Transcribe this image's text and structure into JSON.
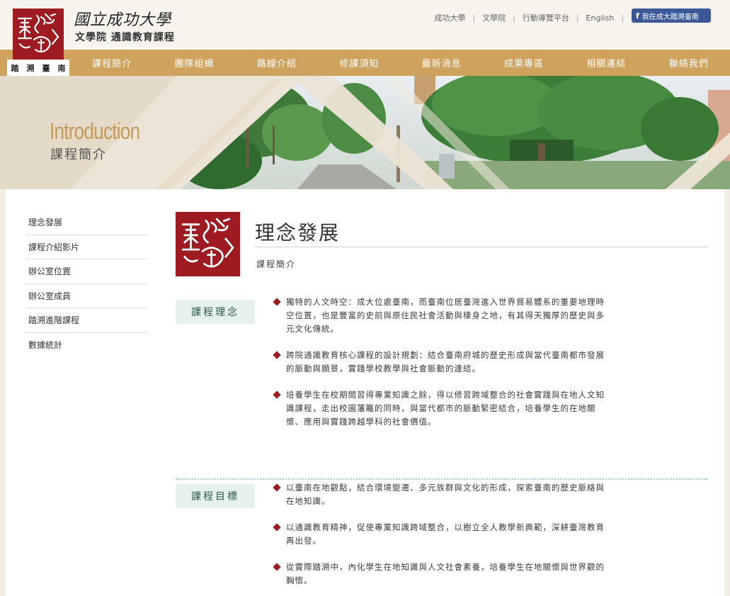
{
  "header": {
    "school_name": "國立成功大學",
    "college_name": "文學院 通識教育課程",
    "motto": [
      "踏",
      "溯",
      "臺",
      "南"
    ],
    "top_links": [
      "成功大學",
      "文學院",
      "行動導覽平台",
      "English"
    ],
    "fb_label": "我在成大踏溯臺南",
    "fb_icon": "f"
  },
  "nav": {
    "items": [
      "課程簡介",
      "團隊組織",
      "路線介紹",
      "修課須知",
      "最新消息",
      "成果專區",
      "相關連結",
      "聯絡我們"
    ]
  },
  "banner": {
    "title_en": "Introduction",
    "title_zh": "課程簡介"
  },
  "sidebar": {
    "items": [
      "理念發展",
      "課程介紹影片",
      "辦公室位置",
      "辦公室成員",
      "踏溯進階課程",
      "數據統計"
    ]
  },
  "main": {
    "title": "理念發展",
    "breadcrumb": "課程簡介",
    "sections": [
      {
        "label": "課程理念",
        "items": [
          "獨特的人文時空：成大位處臺南，而臺南位居臺灣進入世界貿易體系的重要地理時空位置，也是豐富的史前與原住民社會活動與棲身之地，有其得天獨厚的歷史與多元文化傳統。",
          "跨院通識教育核心課程的設計規劃：結合臺南府城的歷史形成與當代臺南都市發展的脈動與願景，實踐學校教學與社會脈動的連結。",
          "培養學生在校期間習得專業知識之餘，得以修習跨域整合的社會實踐與在地人文知識課程，走出校園藩籬的同時，與當代都市的脈動緊密結合，培養學生的在地關懷、應用與實踐跨越學科的社會價值。"
        ]
      },
      {
        "label": "課程目標",
        "items": [
          "以臺南在地觀點，結合環境變遷、多元族群與文化的形成，探索臺南的歷史脈絡與在地知識。",
          "以通識教育精神，促使專業知識跨域整合，以樹立全人教學新典範，深耕臺灣教育再出發。",
          "從實際踏溯中，內化學生在地知識與人文社會素養，培養學生在地關懷與世界觀的胸懷。"
        ]
      }
    ]
  },
  "colors": {
    "nav_bg": "#cfa25e",
    "seal_red": "#9e1b22",
    "label_bg": "#e5f1ea"
  },
  "icons": {
    "logo": "ncku-seal-logo",
    "bullet": "diamond-bullet-icon",
    "facebook": "facebook-icon"
  }
}
